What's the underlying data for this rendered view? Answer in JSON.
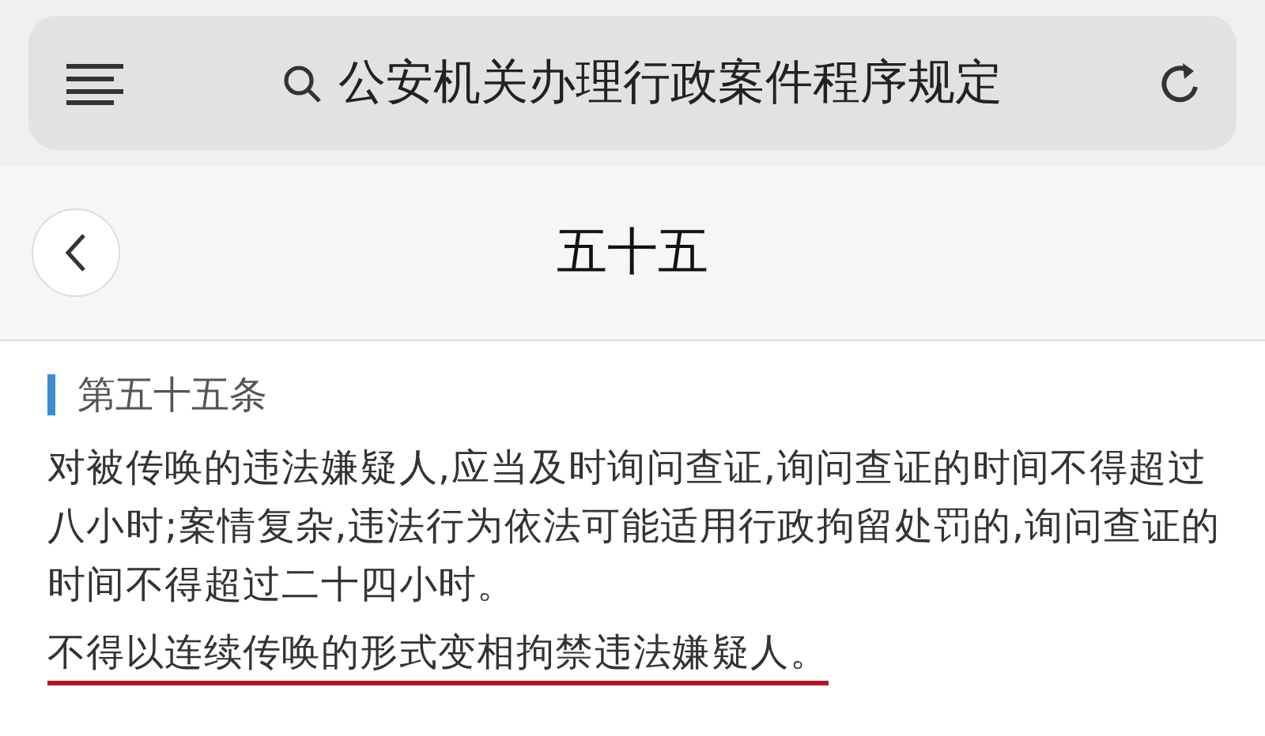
{
  "search_bar": {
    "query": "公安机关办理行政案件程序规定"
  },
  "header": {
    "title": "五十五"
  },
  "article": {
    "heading": "第五十五条",
    "paragraphs": [
      {
        "text": "对被传唤的违法嫌疑人,应当及时询问查证,询问查证的时间不得超过八小时;案情复杂,违法行为依法可能适用行政拘留处罚的,询问查证的时间不得超过二十四小时。",
        "underlined": false
      },
      {
        "text": "不得以连续传唤的形式变相拘禁违法嫌疑人。",
        "underlined": true
      }
    ]
  }
}
